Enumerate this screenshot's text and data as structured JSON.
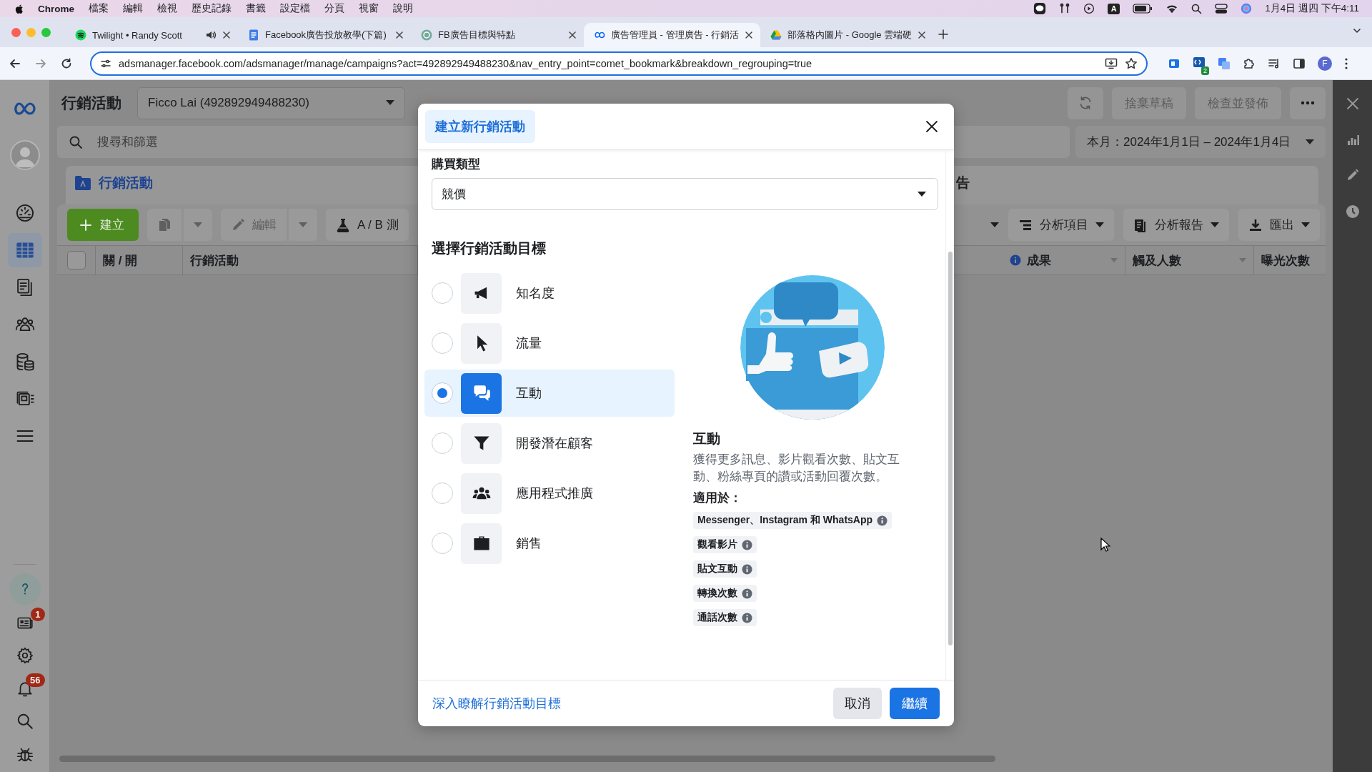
{
  "menu_bar": {
    "app": "Chrome",
    "items": [
      "檔案",
      "編輯",
      "檢視",
      "歷史記錄",
      "書籤",
      "設定檔",
      "分頁",
      "視窗",
      "說明"
    ],
    "input_source": "A",
    "clock": "1月4日 週四 下午4:11"
  },
  "browser": {
    "tabs": [
      {
        "title": "Twilight • Randy Scott",
        "selected": false,
        "audio": true
      },
      {
        "title": "Facebook廣告投放教學(下篇)",
        "selected": false,
        "audio": false
      },
      {
        "title": "FB廣告目標與特點",
        "selected": false,
        "audio": false
      },
      {
        "title": "廣告管理員 - 管理廣告 - 行銷活",
        "selected": true,
        "audio": false
      },
      {
        "title": "部落格內圖片 - Google 雲端硬",
        "selected": false,
        "audio": false
      }
    ],
    "url": "adsmanager.facebook.com/adsmanager/manage/campaigns?act=492892949488230&nav_entry_point=comet_bookmark&breakdown_regrouping=true",
    "extension_badge": "2",
    "profile_initial": "F"
  },
  "sidebar": {
    "items": [
      {
        "selected": false
      },
      {
        "selected": true
      },
      {
        "selected": false
      },
      {
        "selected": false
      },
      {
        "selected": false
      },
      {
        "selected": false
      },
      {
        "selected": false
      }
    ],
    "bottom_items": [
      {
        "kind": "help"
      },
      {
        "kind": "news",
        "badge": "1"
      },
      {
        "kind": "settings"
      },
      {
        "kind": "bell",
        "badge": "56"
      },
      {
        "kind": "search"
      },
      {
        "kind": "bug"
      }
    ]
  },
  "page": {
    "title": "行銷活動",
    "account": "Ficco Lai (492892949488230)",
    "actions": [
      {
        "kind": "refresh"
      },
      {
        "kind": "text",
        "label": "捨棄草稿",
        "disabled": true
      },
      {
        "kind": "text",
        "label": "檢查並發佈",
        "disabled": true
      },
      {
        "kind": "more"
      }
    ],
    "search": {
      "placeholder": "搜尋和篩選"
    },
    "date_range": "本月：2024年1月1日 – 2024年1月4日"
  },
  "level_tabs": [
    {
      "label": "行銷活動",
      "selected": true
    },
    {
      "label": "告",
      "selected": false
    }
  ],
  "toolbar": {
    "left": [
      {
        "kind": "create",
        "label": "建立"
      },
      {
        "kind": "copy",
        "disabled": true
      },
      {
        "kind": "edit",
        "label": "編輯",
        "disabled": true
      },
      {
        "kind": "test",
        "label": "A / B 測"
      }
    ],
    "right": [
      {
        "kind": "caret"
      },
      {
        "kind": "breakdown",
        "label": "分析項目"
      },
      {
        "kind": "reports",
        "label": "分析報告"
      },
      {
        "kind": "export",
        "label": "匯出"
      }
    ]
  },
  "table": {
    "select_all_checked": false,
    "left_columns": [
      {
        "label": "關 / 開"
      },
      {
        "label": "行銷活動"
      }
    ],
    "right_columns": [
      {
        "label": "成果",
        "info": true,
        "sortable": true
      },
      {
        "label": "觸及人數",
        "sortable": true
      },
      {
        "label": "曝光次數"
      }
    ]
  },
  "dialog": {
    "title": "建立新行銷活動",
    "buying_type": {
      "label": "購買類型",
      "value": "競價"
    },
    "heading": "選擇行銷活動目標",
    "objectives": [
      {
        "label": "知名度",
        "selected": false
      },
      {
        "label": "流量",
        "selected": false
      },
      {
        "label": "互動",
        "selected": true
      },
      {
        "label": "開發潛在顧客",
        "selected": false
      },
      {
        "label": "應用程式推廣",
        "selected": false
      },
      {
        "label": "銷售",
        "selected": false
      }
    ],
    "detail": {
      "title": "互動",
      "description": "獲得更多訊息、影片觀看次數、貼文互動、粉絲專頁的讚或活動回覆次數。",
      "applies_label": "適用於：",
      "chips": [
        "Messenger、Instagram 和 WhatsApp",
        "觀看影片",
        "貼文互動",
        "轉換次數",
        "通話次數"
      ]
    },
    "learn_more": "深入瞭解行銷活動目標",
    "buttons": [
      {
        "label": "取消",
        "kind": "secondary"
      },
      {
        "label": "繼續",
        "kind": "primary"
      }
    ]
  }
}
